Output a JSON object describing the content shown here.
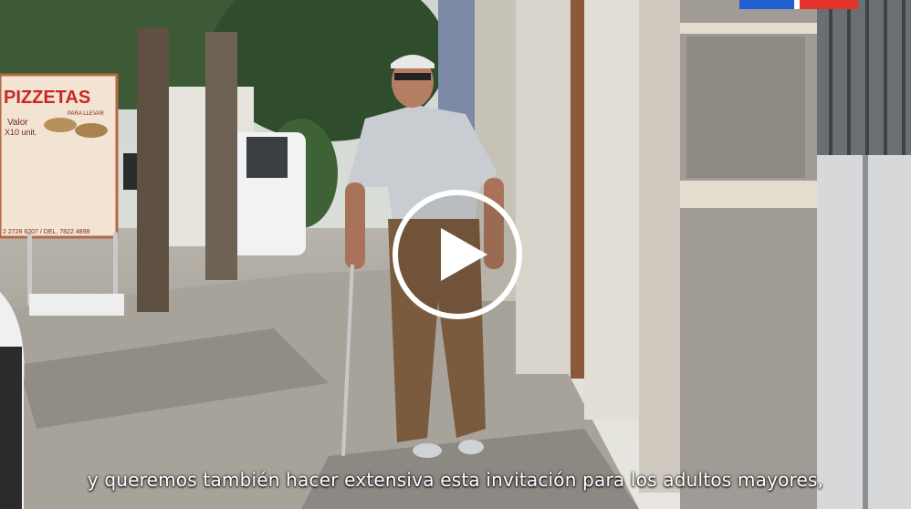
{
  "video": {
    "sign": {
      "title": "PIZZETAS",
      "small_top": "PARA LLEVAR",
      "valor": "Valor",
      "price_fragment": "X10 unit.",
      "phones": "2 2728 6207 / DEL. 7822 4898"
    },
    "flag_colors": {
      "blue": "#1f5fd1",
      "white": "#ffffff",
      "red": "#e2332b"
    },
    "play_icon": "play-icon",
    "caption": "y queremos también hacer extensiva esta invitación para los adultos mayores,"
  }
}
